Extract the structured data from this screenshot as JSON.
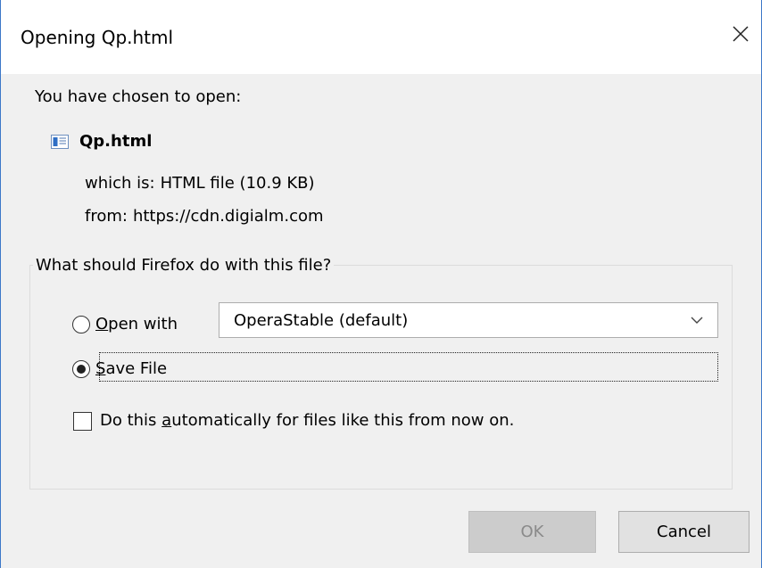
{
  "window": {
    "title": "Opening Qp.html",
    "close_icon": "close-icon"
  },
  "prompt": "You have chosen to open:",
  "file": {
    "name": "Qp.html",
    "icon": "html-file-icon",
    "type_label": "which is:",
    "type_value": "HTML file (10.9 KB)",
    "from_label": "from:",
    "from_value": "https://cdn.digialm.com"
  },
  "action_group": {
    "legend": "What should Firefox do with this file?",
    "open_with": {
      "label_mnemonic": "O",
      "label_rest": "pen with",
      "selected": false,
      "app": "OperaStable (default)"
    },
    "save_file": {
      "label_mnemonic": "S",
      "label_rest": "ave File",
      "selected": true
    },
    "auto_checkbox": {
      "label_before": "Do this ",
      "label_mnemonic": "a",
      "label_after": "utomatically for files like this from now on.",
      "checked": false
    }
  },
  "buttons": {
    "ok": "OK",
    "ok_enabled": false,
    "cancel": "Cancel"
  },
  "colors": {
    "dialog_bg": "#f0f0f0",
    "window_border": "#3c78c8",
    "ok_disabled_text": "#8a8a8a"
  }
}
